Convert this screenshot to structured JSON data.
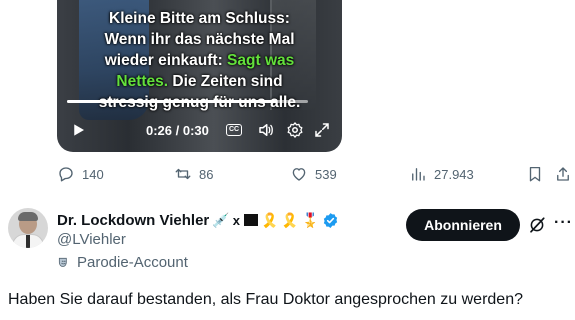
{
  "video": {
    "subtitle_line1": "Kleine Bitte am Schluss:",
    "subtitle_line2": "Wenn ihr das nächste Mal",
    "subtitle_line3_a": "wieder einkauft: ",
    "subtitle_line3_b": "Sagt was",
    "subtitle_line4_a": "Nettes.",
    "subtitle_line4_b": " Die Zeiten sind",
    "subtitle_line5": "stressig genug für uns alle.",
    "time_display": "0:26 / 0:30",
    "progress_fraction": 0.867,
    "cc_label": "CC",
    "highlight_color": "#63e03b"
  },
  "actions": {
    "replies": "140",
    "reposts": "86",
    "likes": "539",
    "views": "27.943"
  },
  "author": {
    "display_name": "Dr. Lockdown Viehler",
    "name_emojis": [
      "💉",
      "🎗️",
      "🎗️",
      "🎖️"
    ],
    "name_x": "x",
    "handle": "@LViehler",
    "parody_label": "Parodie-Account",
    "follow_label": "Abonnieren",
    "more_label": "···",
    "verified_color": "#1d9bf0"
  },
  "tweet": {
    "text": "Haben Sie darauf bestanden, als Frau Doktor angesprochen zu werden?"
  }
}
